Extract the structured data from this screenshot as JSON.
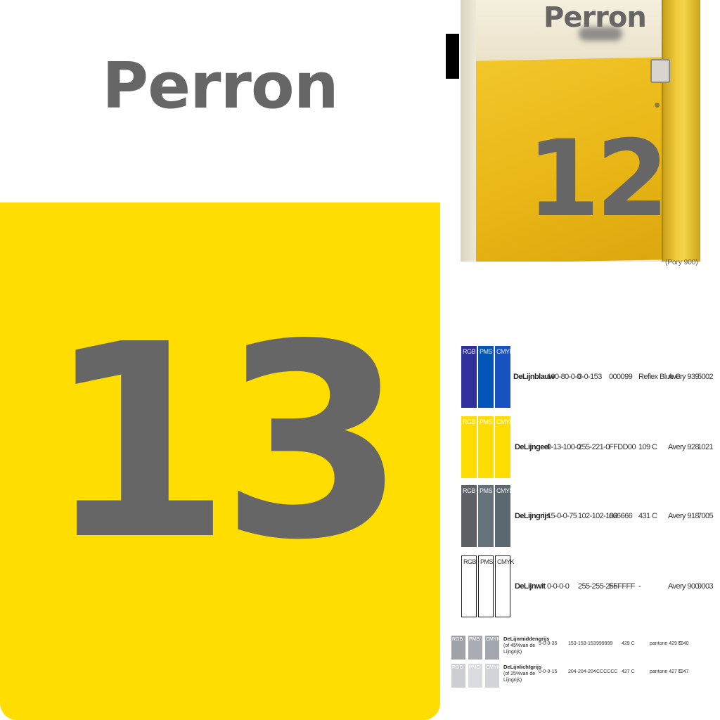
{
  "colors": {
    "yellow": "#FFDD00",
    "gray": "#666666",
    "white": "#FFFFFF",
    "blue": "#2B2A9B"
  },
  "main_sign": {
    "label": "Perron",
    "number": "13"
  },
  "photo_sign": {
    "label": "Perron",
    "number": "12",
    "caption": "(Pory 900)"
  },
  "color_chart": {
    "rows": [
      {
        "swatches": [
          {
            "label": "RGB",
            "color": "#30309C"
          },
          {
            "label": "PMS",
            "color": "#0055B5"
          },
          {
            "label": "CMYK",
            "color": "#1852C0"
          }
        ],
        "name": "DeLijnblauw",
        "values": [
          "100-80-0-0",
          "0-0-153",
          "000099",
          "Reflex Blue C",
          "Avery 939",
          "5002"
        ]
      },
      {
        "swatches": [
          {
            "label": "RGB",
            "color": "#FFDD00"
          },
          {
            "label": "PMS",
            "color": "#FFDD00"
          },
          {
            "label": "CMYK",
            "color": "#FFDD00"
          }
        ],
        "name": "DeLijngeel",
        "values": [
          "0-13-100-0",
          "255-221-0",
          "FFDD00",
          "109 C",
          "Avery 928",
          "1021"
        ]
      },
      {
        "swatches": [
          {
            "label": "RGB",
            "color": "#5E6166"
          },
          {
            "label": "PMS",
            "color": "#66727A"
          },
          {
            "label": "CMYK",
            "color": "#5C6870"
          }
        ],
        "name": "DeLijngrijs",
        "values": [
          "15-0-0-75",
          "102-102-102",
          "666666",
          "431 C",
          "Avery 918",
          "7005"
        ]
      },
      {
        "swatches": [
          {
            "label": "RGB",
            "color": "#FFFFFF"
          },
          {
            "label": "PMS",
            "color": "#FFFFFF"
          },
          {
            "label": "CMYK",
            "color": "#FFFFFF"
          }
        ],
        "name": "DeLijnwit",
        "values": [
          "0-0-0-0",
          "255-255-255",
          "FFFFFF",
          "-",
          "Avery 900",
          "9003"
        ]
      }
    ],
    "small_rows": [
      {
        "swatches": [
          {
            "label": "RGB",
            "color": "#9FA2A8"
          },
          {
            "label": "PMS",
            "color": "#A9ADB3"
          },
          {
            "label": "CMYK",
            "color": "#A2A7AD"
          }
        ],
        "name": "DeLijnmiddengrijs",
        "note": "(of 45%van de Lijngrijs)",
        "values": [
          "5-0-0-35",
          "153-153-153",
          "999999",
          "429 C",
          "pantone 429 C",
          "7040"
        ]
      },
      {
        "swatches": [
          {
            "label": "RGB",
            "color": "#CCCED1"
          },
          {
            "label": "PMS",
            "color": "#DADCDF"
          },
          {
            "label": "CMYK",
            "color": "#D2D4D7"
          }
        ],
        "name": "DeLijnlichtgrijs",
        "note": "(of 25%van de Lijngrijs)",
        "values": [
          "0-0-0-15",
          "204-204-204",
          "CCCCCC",
          "427 C",
          "pantone 427 C",
          "7047"
        ]
      }
    ]
  }
}
